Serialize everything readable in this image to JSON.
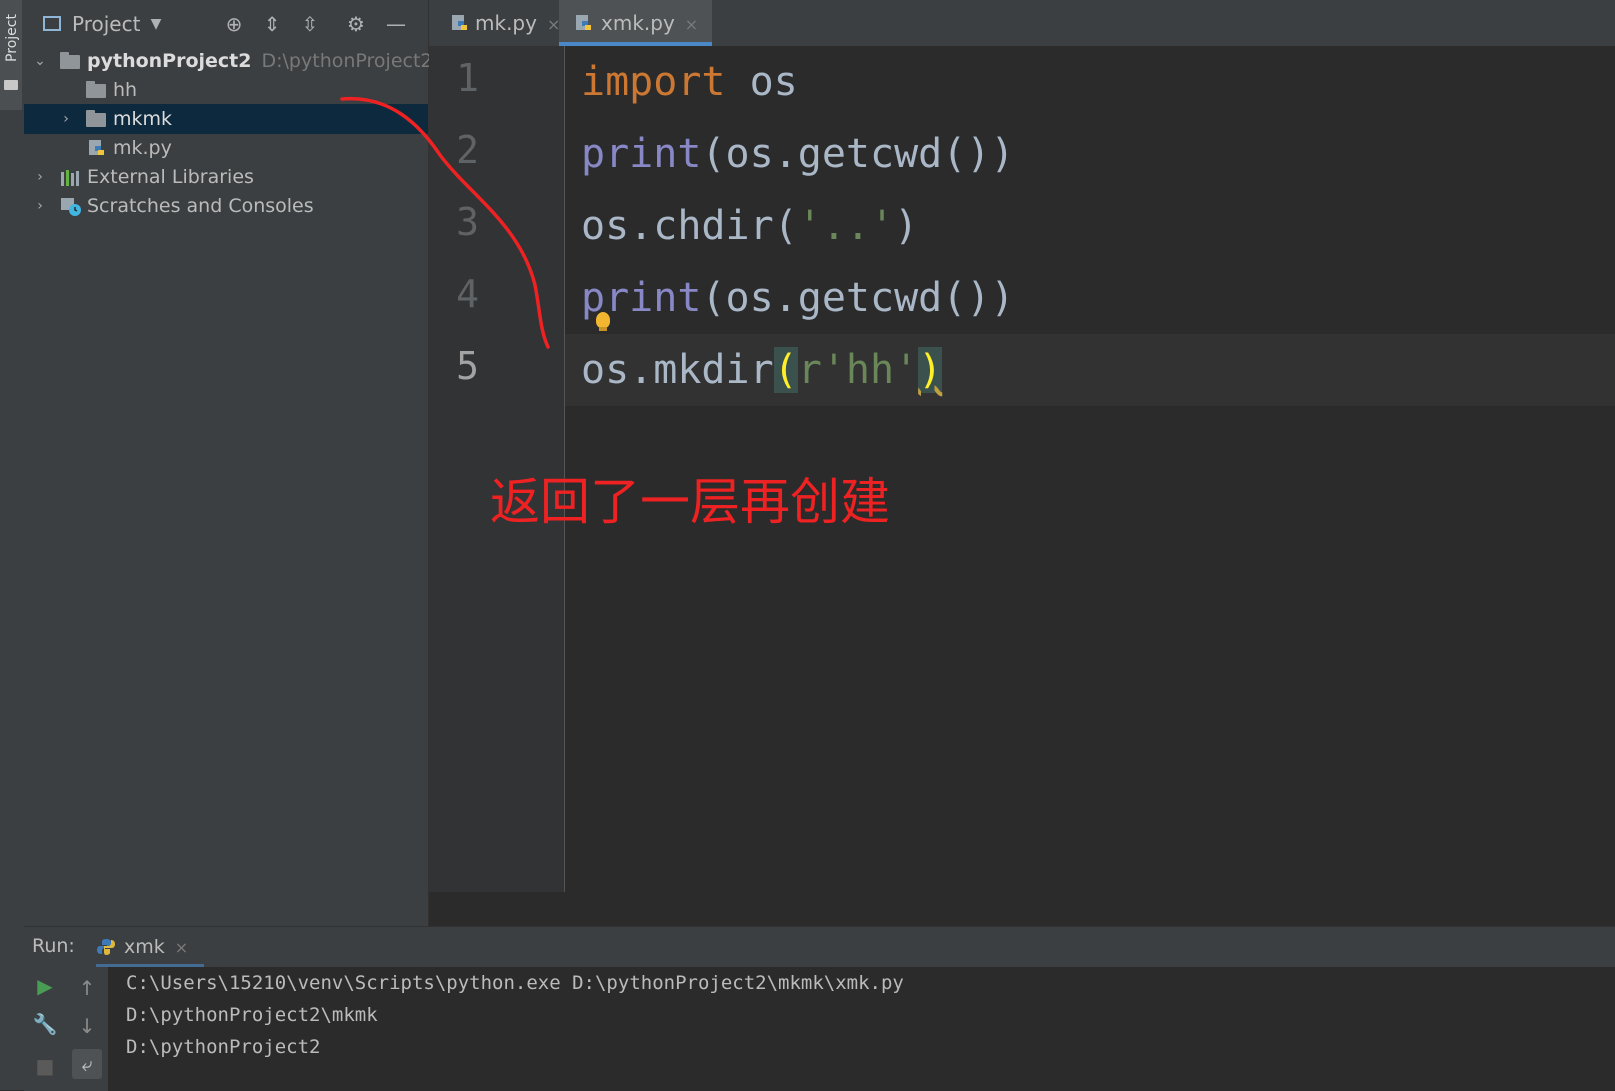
{
  "stripe": {
    "label": "Project"
  },
  "project_panel": {
    "title": "Project",
    "tree": {
      "root_name": "pythonProject2",
      "root_path": "D:\\pythonProject2",
      "items": [
        {
          "label": "hh"
        },
        {
          "label": "mkmk"
        },
        {
          "label": "mk.py"
        },
        {
          "label": "External Libraries"
        },
        {
          "label": "Scratches and Consoles"
        }
      ]
    }
  },
  "editor": {
    "tabs": [
      {
        "label": "mk.py",
        "close": "×"
      },
      {
        "label": "xmk.py",
        "close": "×"
      }
    ],
    "line_numbers": [
      "1",
      "2",
      "3",
      "4",
      "5"
    ],
    "code": {
      "l1_kw": "import",
      "l1_rest": " os",
      "l2_fn": "print",
      "l2_rest": "(os.getcwd())",
      "l3_pre": "os.chdir(",
      "l3_str": "'..'",
      "l3_post": ")",
      "l4_fn": "print",
      "l4_rest": "(os.getcwd())",
      "l5_pre": "os.mkdir",
      "l5_open": "(",
      "l5_str": "r'hh'",
      "l5_close": ")"
    },
    "annotation": "返回了一层再创建"
  },
  "run_panel": {
    "label": "Run:",
    "tab": "xmk",
    "tab_close": "×",
    "output": [
      "C:\\Users\\15210\\venv\\Scripts\\python.exe D:\\pythonProject2\\mkmk\\xmk.py",
      "D:\\pythonProject2\\mkmk",
      "D:\\pythonProject2"
    ]
  },
  "colors": {
    "keyword": "#cc7832",
    "builtin": "#8888c6",
    "string": "#6a8759",
    "annotation": "#ee2222",
    "selection": "#0d293e"
  }
}
